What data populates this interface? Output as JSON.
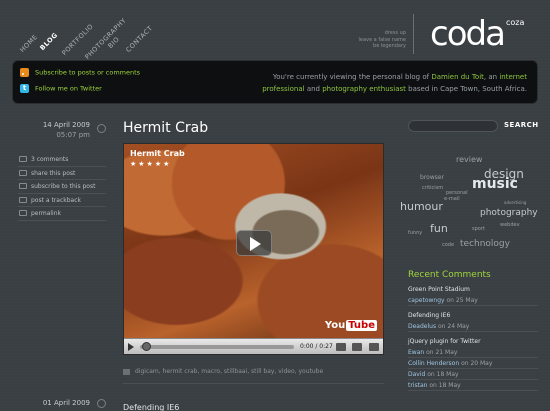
{
  "nav": {
    "items": [
      "HOME",
      "BLOG",
      "PORTFOLIO",
      "PHOTOGRAPHY",
      "BIO",
      "CONTACT"
    ],
    "active": "BLOG"
  },
  "tagline": [
    "dress up",
    "leave a false name",
    "be legendary"
  ],
  "logo": {
    "word": "coda",
    "sup": "coza"
  },
  "bar": {
    "subscribe": "Subscribe to posts or comments",
    "twitter": "Follow me on Twitter",
    "blurb": {
      "p1": "You're currently viewing the personal blog of ",
      "name": "Damien du Toit",
      "p2": ", an ",
      "prof": "internet professional",
      "p3": " and ",
      "photo": "photography enthusiast",
      "p4": " based in Cape Town, South Africa."
    }
  },
  "post": {
    "date": "14 April 2009",
    "time": "05:07 pm",
    "title": "Hermit Crab",
    "meta": [
      "3 comments",
      "share this post",
      "subscribe to this post",
      "post a trackback",
      "permalink"
    ],
    "video": {
      "title": "Hermit Crab",
      "stars": "★★★★★",
      "time": "0:00 / 0:27",
      "brand_a": "You",
      "brand_b": "Tube"
    },
    "tags": "digicam, hermit crab, macro, stillbaai, still bay, video, youtube"
  },
  "next_post": {
    "date": "01 April 2009",
    "title": "Defending IE6"
  },
  "sidebar": {
    "search_button": "SEARCH",
    "cloud": [
      "review",
      "browser",
      "music",
      "design",
      "criticism",
      "personal",
      "humour",
      "e-mail",
      "photography",
      "fun",
      "sport",
      "technology",
      "advertising",
      "webdev",
      "code",
      "funny"
    ],
    "recent_heading": "Recent Comments",
    "recent": [
      {
        "post": "Green Point Stadium",
        "comments": [
          {
            "who": "capetowngy",
            "when": "on 25 May"
          }
        ]
      },
      {
        "post": "Defending IE6",
        "comments": [
          {
            "who": "Deadelus",
            "when": "on 24 May"
          }
        ]
      },
      {
        "post": "jQuery plugin for Twitter",
        "comments": [
          {
            "who": "Ewan",
            "when": "on 21 May"
          },
          {
            "who": "Collin Henderson",
            "when": "on 20 May"
          },
          {
            "who": "David",
            "when": "on 18 May"
          },
          {
            "who": "tristan",
            "when": "on 18 May"
          }
        ]
      }
    ]
  },
  "colors": {
    "accent": "#9fd53b",
    "background": "#3a3f44",
    "bar": "#0d0f10"
  }
}
